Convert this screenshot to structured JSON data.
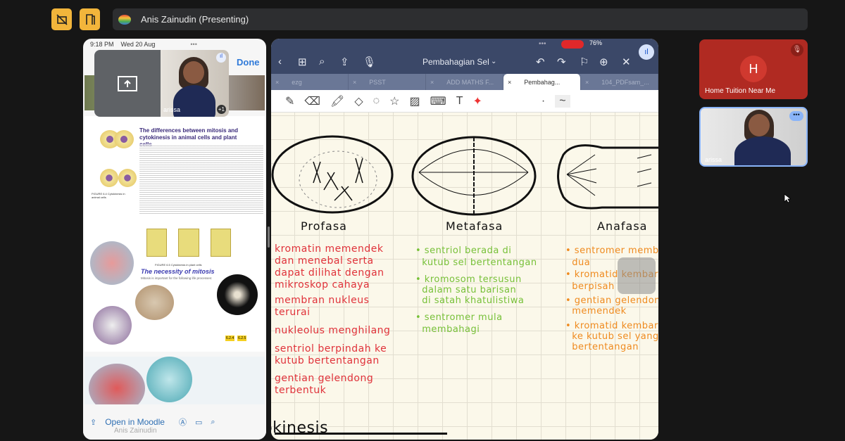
{
  "meeting": {
    "presenter_title": "Anis Zainudin (Presenting)",
    "icons": [
      "no-camera-icon",
      "leave-door-icon"
    ]
  },
  "ipad_left": {
    "time": "9:18 PM",
    "date": "Wed 20 Aug",
    "done_label": "Done",
    "pip_name": "arissa",
    "pip_more": "+1",
    "book": {
      "heading1": "The differences between mitosis and cytokinesis in animal cells and plant cells",
      "figure1": "FIGURE 6.4 Cytokinesis in animal cells",
      "figure2": "FIGURE 6.5 Cytokinesis in plant cells",
      "heading2": "The necessity of mitosis",
      "intro2": "Mitosis is important for the following life processes:",
      "tags": [
        "6.2.4",
        "6.2.5"
      ]
    },
    "bottom": {
      "open_label": "Open in Moodle",
      "sharer": "Anis Zainudin"
    }
  },
  "notes_app": {
    "battery": "76%",
    "doc_title": "Pembahagian Sel",
    "tabs": [
      {
        "label": "ezg"
      },
      {
        "label": "PSST"
      },
      {
        "label": "ADD MATHS F..."
      },
      {
        "label": "Pembahag...",
        "active": true
      },
      {
        "label": "104_PDFsam_..."
      }
    ],
    "phases": [
      "Profasa",
      "Metafasa",
      "Anafasa"
    ],
    "profasa_notes": [
      "kromatin memendek\ndan menebal serta\ndapat dilihat dengan\nmikroskop cahaya",
      "membran nukleus\nterurai",
      "nukleolus menghilang",
      "sentriol berpindah ke\nkutub bertentangan",
      "gentian gelendong\nterbentuk"
    ],
    "metafasa_notes": [
      "• sentriol berada di\n  kutub sel bertentangan",
      "• kromosom tersusun\n  dalam satu barisan\n  di satah khatulistiwa",
      "• sentromer mula\n  membahagi"
    ],
    "anafasa_notes": [
      "• sentromer memb\n  dua",
      "• kromatid kembar\n  berpisah",
      "• gentian gelendong\n  memendek",
      "• kromatid kembar\n  ke kutub sel yang\n  bertentangan"
    ],
    "bottom_heading": "Sitokinesis"
  },
  "participants": [
    {
      "name": "Home Tuition Near Me",
      "initial": "H",
      "muted": true,
      "color": "#b02a22"
    },
    {
      "name": "arissa"
    }
  ]
}
